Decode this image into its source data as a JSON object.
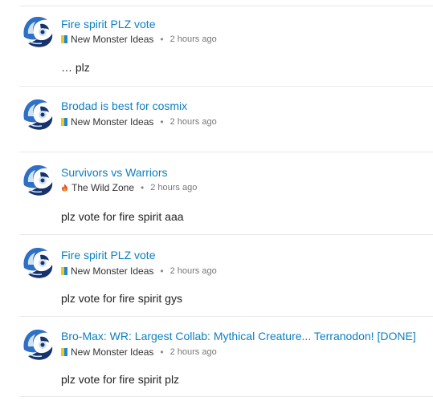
{
  "posts": [
    {
      "title": "Fire spirit PLZ vote",
      "category": "New Monster Ideas",
      "category_icon": "yellow-blue-badge",
      "category_colors": [
        "#f5c518",
        "#1a8ad8"
      ],
      "separator": "•",
      "time": "2 hours ago",
      "excerpt": "… plz"
    },
    {
      "title": "Brodad is best for cosmix",
      "category": "New Monster Ideas",
      "category_icon": "yellow-blue-badge",
      "category_colors": [
        "#f5c518",
        "#1a8ad8"
      ],
      "separator": "•",
      "time": "2 hours ago",
      "excerpt": ""
    },
    {
      "title": "Survivors vs Warriors",
      "category": "The Wild Zone",
      "category_icon": "flame-icon",
      "category_colors": [
        "#e05a2a",
        "#f0a030"
      ],
      "separator": "•",
      "time": "2 hours ago",
      "excerpt": "plz vote for fire spirit aaa"
    },
    {
      "title": "Fire spirit PLZ vote",
      "category": "New Monster Ideas",
      "category_icon": "yellow-blue-badge",
      "category_colors": [
        "#f5c518",
        "#1a8ad8"
      ],
      "separator": "•",
      "time": "2 hours ago",
      "excerpt": "plz vote for fire spirit gys"
    },
    {
      "title": "Bro-Max: WR: Largest Collab: Mythical Creature... Terranodon! [DONE]",
      "category": "New Monster Ideas",
      "category_icon": "yellow-blue-badge",
      "category_colors": [
        "#f5c518",
        "#1a8ad8"
      ],
      "separator": "•",
      "time": "2 hours ago",
      "excerpt": "plz vote for fire spirit plz"
    }
  ],
  "colors": {
    "link": "#0b7fc1",
    "divider": "#e9e9e9",
    "avatar_primary": "#2f6fc4",
    "avatar_dark": "#16336e",
    "avatar_light": "#cfe3f7"
  }
}
